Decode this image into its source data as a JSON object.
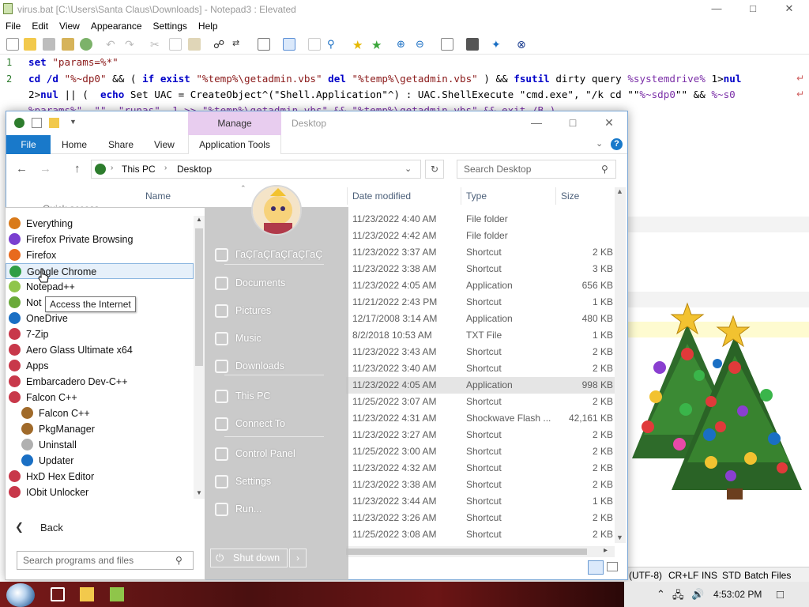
{
  "notepad": {
    "title": "virus.bat [C:\\Users\\Santa Claus\\Downloads] - Notepad3 : Elevated",
    "menu": [
      "File",
      "Edit",
      "View",
      "Appearance",
      "Settings",
      "Help"
    ],
    "line_numbers": [
      "1",
      "2"
    ],
    "line1": {
      "kw": "set",
      "str": "\"params=%*\""
    },
    "line2a": {
      "p1": "cd /d ",
      "s1": "\"%~dp0\"",
      "p2": " && ( ",
      "k1": "if exist",
      "p3": " ",
      "s2": "\"%temp%\\getadmin.vbs\"",
      "p4": " ",
      "k2": "del",
      "p5": " ",
      "s3": "\"%temp%\\getadmin.vbs\"",
      "p6": " ) && ",
      "k3": "fsutil",
      "p7": " dirty query ",
      "v1": "%systemdrive%",
      "p8": " 1>",
      "k4": "nul"
    },
    "line2b": {
      "p1": "2>",
      "k1": "nul",
      "p2": " || (  ",
      "k2": "echo",
      "p3": " Set UAC = CreateObject^(\"Shell.Application\"^) : UAC.ShellExecute \"cmd.exe\", \"/k cd \"\"",
      "v1": "%~sdp0",
      "p4": "\"\" && ",
      "v2": "%~s0"
    },
    "line2c": "%params%\", \"\", \"runas\", 1 >> \"%temp%\\getadmin.vbs\" && \"%temp%\\getadmin.vbs\" && exit /B )",
    "status": {
      "encoding": "(UTF-8)",
      "eol": "CR+LF",
      "ins": "INS",
      "std": "STD",
      "lexer": "Batch Files"
    }
  },
  "explorer": {
    "context_tab": "Manage",
    "window_title": "Desktop",
    "ribbon_tabs": [
      "File",
      "Home",
      "Share",
      "View",
      "Application Tools"
    ],
    "breadcrumb": [
      "This PC",
      "Desktop"
    ],
    "search_placeholder": "Search Desktop",
    "columns": {
      "name": "Name",
      "date": "Date modified",
      "type": "Type",
      "size": "Size"
    },
    "quick_access_partial": "Quick access",
    "rows": [
      {
        "date": "11/23/2022 4:40 AM",
        "type": "File folder",
        "size": ""
      },
      {
        "date": "11/23/2022 4:42 AM",
        "type": "File folder",
        "size": ""
      },
      {
        "date": "11/23/2022 3:37 AM",
        "type": "Shortcut",
        "size": "2 KB"
      },
      {
        "date": "11/23/2022 3:38 AM",
        "type": "Shortcut",
        "size": "3 KB"
      },
      {
        "date": "11/23/2022 4:05 AM",
        "type": "Application",
        "size": "656 KB"
      },
      {
        "date": "11/21/2022 2:43 PM",
        "type": "Shortcut",
        "size": "1 KB"
      },
      {
        "date": "12/17/2008 3:14 AM",
        "type": "Application",
        "size": "480 KB"
      },
      {
        "date": "8/2/2018 10:53 AM",
        "type": "TXT File",
        "size": "1 KB"
      },
      {
        "date": "11/23/2022 3:43 AM",
        "type": "Shortcut",
        "size": "2 KB"
      },
      {
        "date": "11/23/2022 3:40 AM",
        "type": "Shortcut",
        "size": "2 KB"
      },
      {
        "date": "11/23/2022 4:05 AM",
        "type": "Application",
        "size": "998 KB"
      },
      {
        "date": "11/25/2022 3:07 AM",
        "type": "Shortcut",
        "size": "2 KB"
      },
      {
        "date": "11/23/2022 4:31 AM",
        "type": "Shockwave Flash ...",
        "size": "42,161 KB"
      },
      {
        "date": "11/23/2022 3:27 AM",
        "type": "Shortcut",
        "size": "2 KB"
      },
      {
        "date": "11/25/2022 3:00 AM",
        "type": "Shortcut",
        "size": "2 KB"
      },
      {
        "date": "11/23/2022 4:32 AM",
        "type": "Shortcut",
        "size": "2 KB"
      },
      {
        "date": "11/23/2022 3:38 AM",
        "type": "Shortcut",
        "size": "2 KB"
      },
      {
        "date": "11/23/2022 3:44 AM",
        "type": "Shortcut",
        "size": "1 KB"
      },
      {
        "date": "11/23/2022 3:26 AM",
        "type": "Shortcut",
        "size": "2 KB"
      },
      {
        "date": "11/25/2022 3:08 AM",
        "type": "Shortcut",
        "size": "2 KB"
      }
    ]
  },
  "start_menu": {
    "programs": [
      {
        "label": "Everything",
        "icon": "everything-icon",
        "color": "#d97a1a"
      },
      {
        "label": "Firefox Private Browsing",
        "icon": "firefox-private-icon",
        "color": "#7a3fd0"
      },
      {
        "label": "Firefox",
        "icon": "firefox-icon",
        "color": "#e86a1d"
      },
      {
        "label": "Google Chrome",
        "icon": "chrome-icon",
        "color": "#2f9e44"
      },
      {
        "label": "Notepad++",
        "icon": "notepadpp-icon",
        "color": "#8fc54a"
      },
      {
        "label": "Not",
        "icon": "notepad3-icon",
        "color": "#6aaa3a"
      },
      {
        "label": "OneDrive",
        "icon": "onedrive-icon",
        "color": "#1a6fc4"
      },
      {
        "label": "7-Zip",
        "icon": "folder-program-icon",
        "color": "#c8384a"
      },
      {
        "label": "Aero Glass Ultimate x64",
        "icon": "folder-program-icon",
        "color": "#c8384a"
      },
      {
        "label": "Apps",
        "icon": "folder-program-icon",
        "color": "#c8384a"
      },
      {
        "label": "Embarcadero Dev-C++",
        "icon": "folder-program-icon",
        "color": "#c8384a"
      },
      {
        "label": "Falcon C++",
        "icon": "folder-program-icon",
        "color": "#c8384a"
      },
      {
        "label": "Falcon C++",
        "icon": "falcon-icon",
        "color": "#a06a2a",
        "indent": true
      },
      {
        "label": "PkgManager",
        "icon": "pkgmanager-icon",
        "color": "#a06a2a",
        "indent": true
      },
      {
        "label": "Uninstall",
        "icon": "uninstall-icon",
        "color": "#b0b0b0",
        "indent": true
      },
      {
        "label": "Updater",
        "icon": "updater-icon",
        "color": "#1a6fc4",
        "indent": true
      },
      {
        "label": "HxD Hex Editor",
        "icon": "folder-program-icon",
        "color": "#c8384a"
      },
      {
        "label": "IObit Unlocker",
        "icon": "folder-program-icon",
        "color": "#c8384a"
      }
    ],
    "tooltip": "Access the Internet",
    "back_label": "Back",
    "search_placeholder": "Search programs and files",
    "right_items": [
      {
        "label": "ГаÇГаÇГаÇГаÇГаÇ",
        "icon": "user-folder-icon"
      },
      {
        "label": "Documents",
        "icon": "documents-icon"
      },
      {
        "label": "Pictures",
        "icon": "pictures-icon"
      },
      {
        "label": "Music",
        "icon": "music-icon"
      },
      {
        "label": "Downloads",
        "icon": "downloads-icon"
      },
      {
        "label": "This PC",
        "icon": "this-pc-icon"
      },
      {
        "label": "Connect To",
        "icon": "connect-to-icon"
      },
      {
        "label": "Control Panel",
        "icon": "control-panel-icon"
      },
      {
        "label": "Settings",
        "icon": "settings-icon"
      },
      {
        "label": "Run...",
        "icon": "run-icon"
      }
    ],
    "shutdown_label": "Shut down"
  },
  "taskbar": {
    "clock": "4:53:02 PM"
  },
  "colors": {
    "explorer_file_tab": "#1979ca",
    "manage_tab": "#e8cdef",
    "selection": "#e5e5e5"
  }
}
